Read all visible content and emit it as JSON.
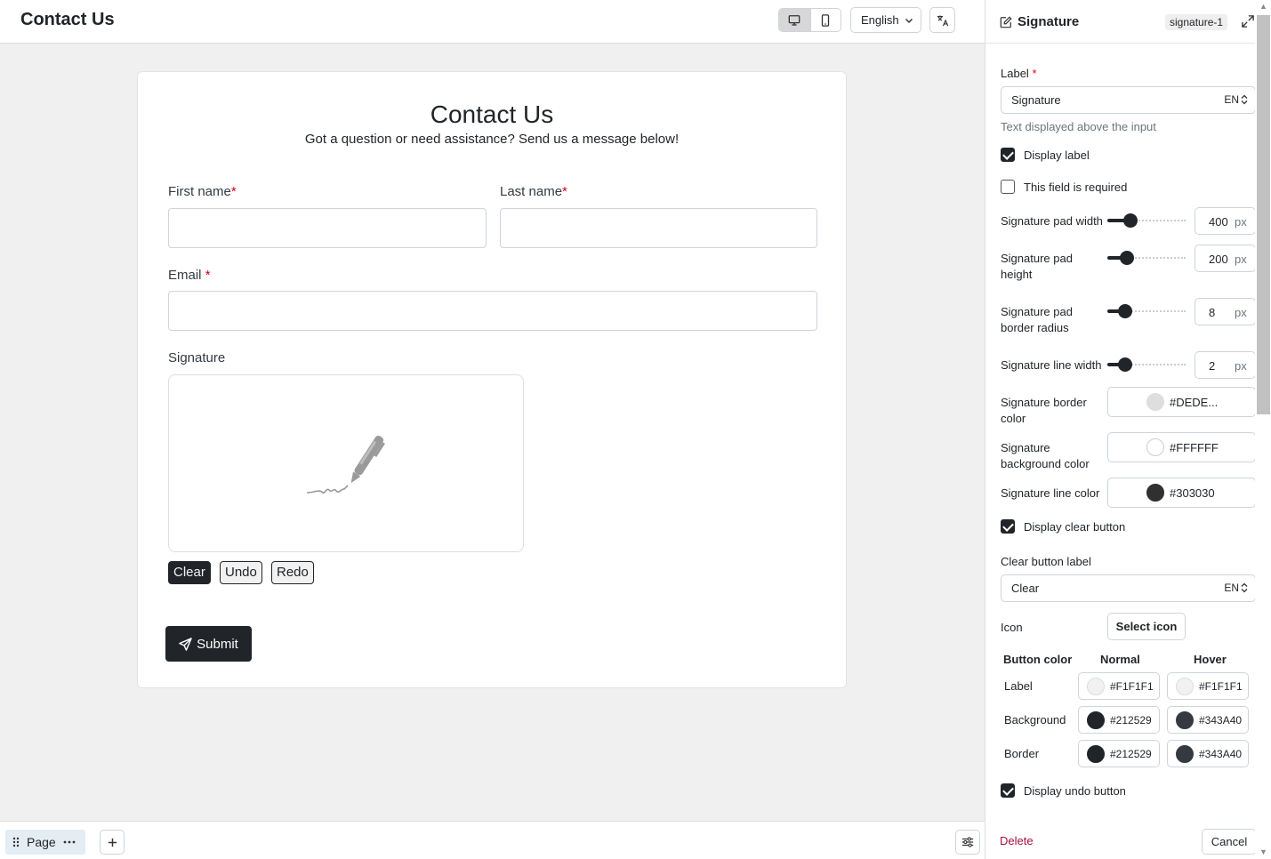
{
  "topbar": {
    "title": "Contact Us",
    "devices": [
      "desktop-icon",
      "mobile-icon"
    ],
    "language": "English"
  },
  "form": {
    "heading": "Contact Us",
    "subheading": "Got a question or need assistance? Send us a message below!",
    "first_name_label": "First name",
    "last_name_label": "Last name",
    "email_label": "Email",
    "required_mark": "*",
    "signature_label": "Signature",
    "clear_label": "Clear",
    "undo_label": "Undo",
    "redo_label": "Redo",
    "submit_label": "Submit"
  },
  "bottombar": {
    "page_label": "Page"
  },
  "panel": {
    "title": "Signature",
    "element_id": "signature-1",
    "label_field_label": "Label",
    "label_value": "Signature",
    "lang_code": "EN",
    "label_help": "Text displayed above the input",
    "display_label": "Display label",
    "required_label": "This field is required",
    "pad_width_label": "Signature pad width",
    "pad_width": "400",
    "pad_height_label": "Signature pad height",
    "pad_height": "200",
    "pad_radius_label": "Signature pad border radius",
    "pad_radius": "8",
    "line_width_label": "Signature line width",
    "line_width": "2",
    "unit": "px",
    "border_color_label": "Signature border color",
    "border_color": "#DEDE...",
    "bg_color_label": "Signature background color",
    "bg_color": "#FFFFFF",
    "line_color_label": "Signature line color",
    "line_color": "#303030",
    "display_clear": "Display clear button",
    "clear_label_label": "Clear button label",
    "clear_label_value": "Clear",
    "icon_label": "Icon",
    "select_icon": "Select icon",
    "col_button_color": "Button color",
    "col_normal": "Normal",
    "col_hover": "Hover",
    "row_label": "Label",
    "row_background": "Background",
    "row_border": "Border",
    "label_normal": "#F1F1F1",
    "label_hover": "#F1F1F1",
    "bg_normal": "#212529",
    "bg_hover": "#343A40",
    "border_normal": "#212529",
    "border_hover": "#343A40",
    "display_undo": "Display undo button",
    "delete": "Delete",
    "cancel": "Cancel"
  },
  "colors": {
    "accent": "#212529",
    "required": "#d0021b",
    "canvas_bg": "#f0f0f0",
    "delete": "#a4133c"
  }
}
